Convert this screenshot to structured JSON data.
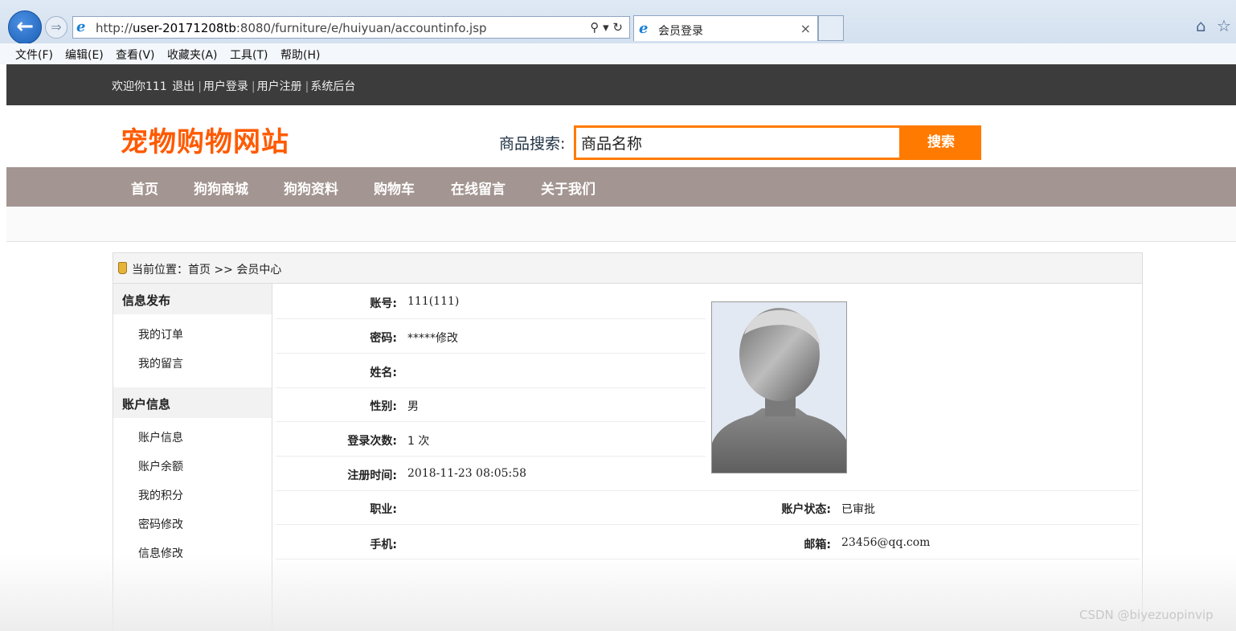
{
  "browser": {
    "url_prefix": "http://",
    "url_host": "user-20171208tb",
    "url_rest": ":8080/furniture/e/huiyuan/accountinfo.jsp",
    "tab_title": "会员登录",
    "menu": [
      "文件(F)",
      "编辑(E)",
      "查看(V)",
      "收藏夹(A)",
      "工具(T)",
      "帮助(H)"
    ]
  },
  "topbar": {
    "welcome": "欢迎你111",
    "logout": "退出",
    "login": "用户登录",
    "register": "用户注册",
    "admin": "系统后台"
  },
  "header": {
    "logo": "宠物购物网站",
    "search_label": "商品搜索:",
    "search_value": "商品名称",
    "search_button": "搜索"
  },
  "nav": [
    "首页",
    "狗狗商城",
    "狗狗资料",
    "购物车",
    "在线留言",
    "关于我们"
  ],
  "breadcrumb": "当前位置：首页 >> 会员中心",
  "sidebar": {
    "group1": "信息发布",
    "group1_items": [
      "我的订单",
      "我的留言"
    ],
    "group2": "账户信息",
    "group2_items": [
      "账户信息",
      "账户余额",
      "我的积分",
      "密码修改",
      "信息修改"
    ]
  },
  "account": {
    "username_label": "账号:",
    "username": "111(111)",
    "password_label": "密码:",
    "password": "*****修改",
    "name_label": "姓名:",
    "name": "",
    "gender_label": "性别:",
    "gender": "男",
    "logins_label": "登录次数:",
    "logins": "1 次",
    "regtime_label": "注册时间:",
    "regtime": "2018-11-23 08:05:58",
    "job_label": "职业:",
    "job": "",
    "status_label": "账户状态:",
    "status": "已审批",
    "phone_label": "手机:",
    "phone": "",
    "email_label": "邮箱:",
    "email": "23456@qq.com"
  },
  "watermark": "CSDN @biyezuopinvip"
}
